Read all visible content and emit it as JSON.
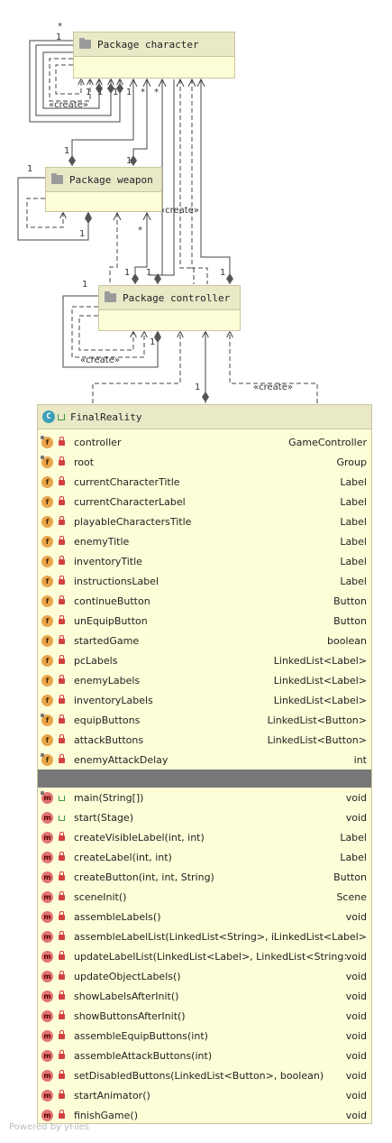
{
  "packages": {
    "character": {
      "label": "Package character"
    },
    "weapon": {
      "label": "Package weapon"
    },
    "controller": {
      "label": "Package controller"
    }
  },
  "class": {
    "name": "FinalReality",
    "icon": "class-icon",
    "fields": [
      {
        "name": "controller",
        "type": "GameController",
        "static": true
      },
      {
        "name": "root",
        "type": "Group",
        "static": true
      },
      {
        "name": "currentCharacterTitle",
        "type": "Label",
        "static": false
      },
      {
        "name": "currentCharacterLabel",
        "type": "Label",
        "static": false
      },
      {
        "name": "playableCharactersTitle",
        "type": "Label",
        "static": false
      },
      {
        "name": "enemyTitle",
        "type": "Label",
        "static": false
      },
      {
        "name": "inventoryTitle",
        "type": "Label",
        "static": false
      },
      {
        "name": "instructionsLabel",
        "type": "Label",
        "static": false
      },
      {
        "name": "continueButton",
        "type": "Button",
        "static": false
      },
      {
        "name": "unEquipButton",
        "type": "Button",
        "static": false
      },
      {
        "name": "startedGame",
        "type": "boolean",
        "static": false
      },
      {
        "name": "pcLabels",
        "type": "LinkedList<Label>",
        "static": false
      },
      {
        "name": "enemyLabels",
        "type": "LinkedList<Label>",
        "static": false
      },
      {
        "name": "inventoryLabels",
        "type": "LinkedList<Label>",
        "static": false
      },
      {
        "name": "equipButtons",
        "type": "LinkedList<Button>",
        "static": true
      },
      {
        "name": "attackButtons",
        "type": "LinkedList<Button>",
        "static": false
      },
      {
        "name": "enemyAttackDelay",
        "type": "int",
        "static": true
      }
    ],
    "methods": [
      {
        "name": "main(String[])",
        "type": "void",
        "static": true,
        "public": true
      },
      {
        "name": "start(Stage)",
        "type": "void",
        "static": false,
        "public": true
      },
      {
        "name": "createVisibleLabel(int, int)",
        "type": "Label",
        "static": false,
        "public": false
      },
      {
        "name": "createLabel(int, int)",
        "type": "Label",
        "static": false,
        "public": false
      },
      {
        "name": "createButton(int, int, String)",
        "type": "Button",
        "static": false,
        "public": false
      },
      {
        "name": "sceneInit()",
        "type": "Scene",
        "static": false,
        "public": false
      },
      {
        "name": "assembleLabels()",
        "type": "void",
        "static": false,
        "public": false
      },
      {
        "name": "assembleLabelList(LinkedList<String>, int)",
        "type": "LinkedList<Label>",
        "static": false,
        "public": false
      },
      {
        "name": "updateLabelList(LinkedList<Label>, LinkedList<String>)",
        "type": "void",
        "static": false,
        "public": false
      },
      {
        "name": "updateObjectLabels()",
        "type": "void",
        "static": false,
        "public": false
      },
      {
        "name": "showLabelsAfterInit()",
        "type": "void",
        "static": false,
        "public": false
      },
      {
        "name": "showButtonsAfterInit()",
        "type": "void",
        "static": false,
        "public": false
      },
      {
        "name": "assembleEquipButtons(int)",
        "type": "void",
        "static": false,
        "public": false
      },
      {
        "name": "assembleAttackButtons(int)",
        "type": "void",
        "static": false,
        "public": false
      },
      {
        "name": "setDisabledButtons(LinkedList<Button>, boolean)",
        "type": "void",
        "static": false,
        "public": false
      },
      {
        "name": "startAnimator()",
        "type": "void",
        "static": false,
        "public": false
      },
      {
        "name": "finishGame()",
        "type": "void",
        "static": false,
        "public": false
      }
    ]
  },
  "edge_labels": {
    "create": "«create»",
    "one": "1",
    "many": "*"
  },
  "watermark": "Powered by yFiles"
}
